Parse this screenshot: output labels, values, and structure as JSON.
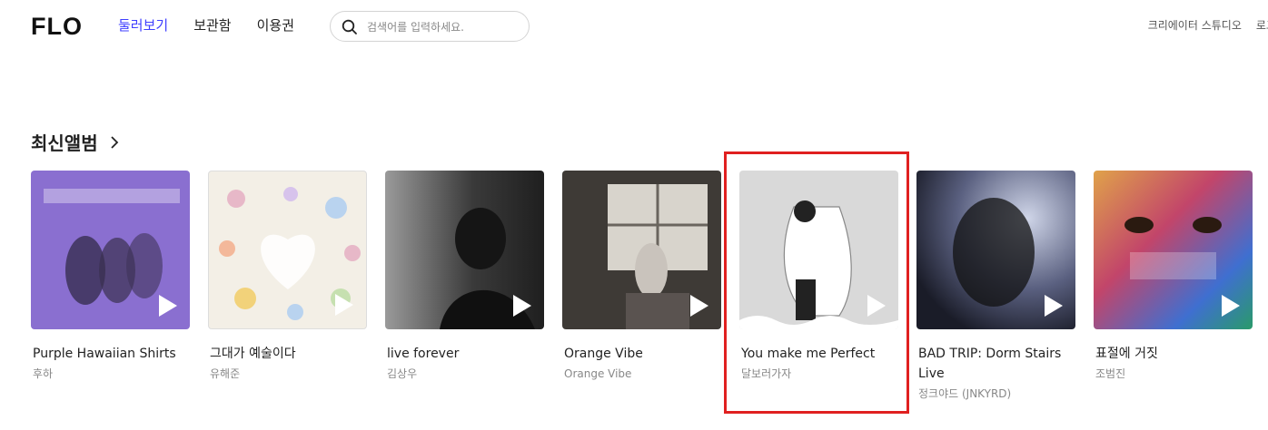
{
  "header": {
    "logo": "FLO",
    "nav": [
      "둘러보기",
      "보관함",
      "이용권"
    ],
    "search_placeholder": "검색어를 입력하세요.",
    "right_links": [
      "크리에이터 스튜디오",
      "로그인"
    ]
  },
  "section": {
    "title": "최신앨범"
  },
  "albums": [
    {
      "title": "Purple Hawaiian Shirts",
      "artist": "후하",
      "cover_color": "#8a6fd0"
    },
    {
      "title": "그대가 예술이다",
      "artist": "유해준",
      "cover_color": "#f3efe6"
    },
    {
      "title": "live forever",
      "artist": "김상우",
      "cover_color": "#3d3d3d"
    },
    {
      "title": "Orange Vibe",
      "artist": "Orange Vibe",
      "cover_color": "#4a4540"
    },
    {
      "title": "You make me Perfect",
      "artist": "달보러가자",
      "cover_color": "#d9d9d9"
    },
    {
      "title": "BAD TRIP: Dorm Stairs Live",
      "artist": "정크야드 (JNKYRD)",
      "cover_color": "#22263a"
    },
    {
      "title": "표절에 거짓",
      "artist": "조범진",
      "cover_color": "#b04a6a"
    }
  ],
  "colors": {
    "accent": "#3f3fff",
    "highlight": "#e02020"
  }
}
